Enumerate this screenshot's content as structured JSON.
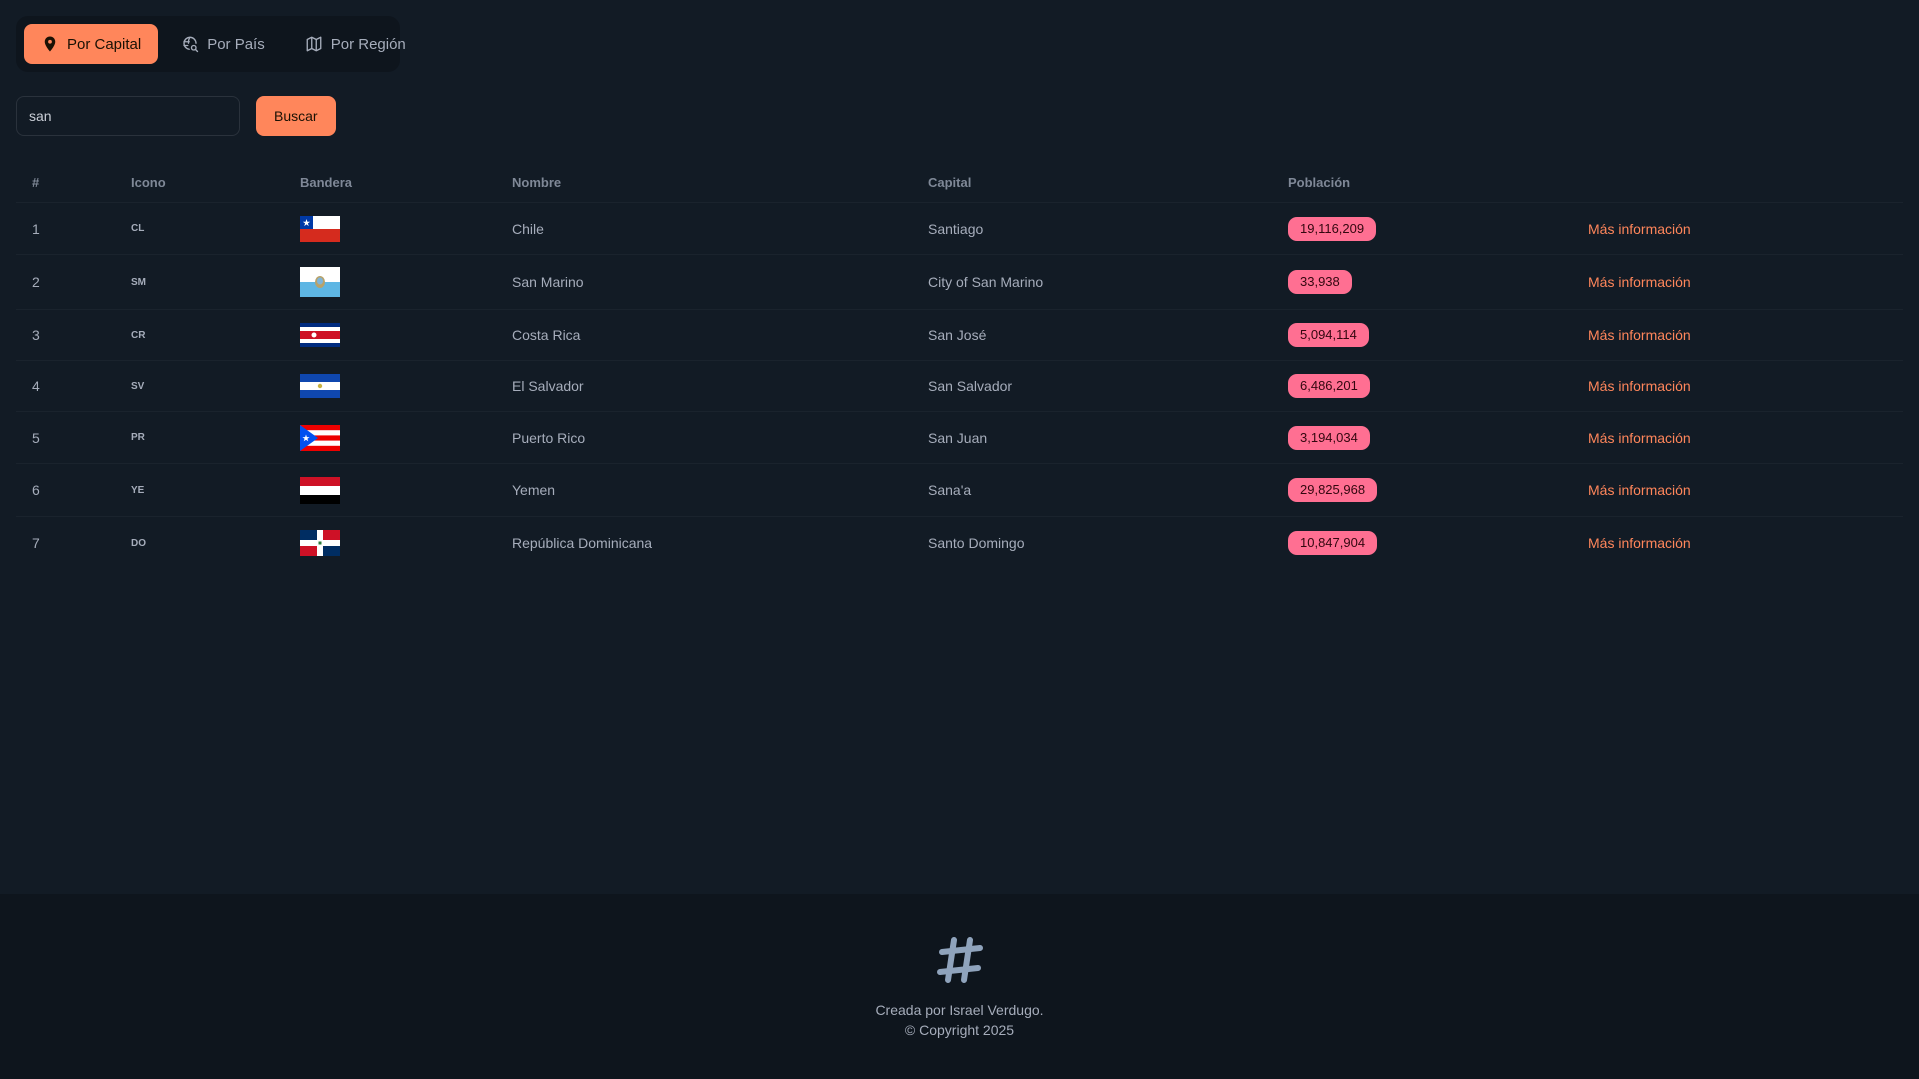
{
  "tabs": [
    {
      "label": "Por Capital",
      "icon": "map-pin-icon",
      "active": true
    },
    {
      "label": "Por País",
      "icon": "globe-search-icon",
      "active": false
    },
    {
      "label": "Por Región",
      "icon": "map-icon",
      "active": false
    }
  ],
  "search": {
    "value": "san",
    "button_label": "Buscar"
  },
  "table": {
    "headers": {
      "num": "#",
      "icon": "Icono",
      "flag": "Bandera",
      "name": "Nombre",
      "capital": "Capital",
      "population": "Población"
    },
    "rows": [
      {
        "num": "1",
        "code": "CL",
        "name": "Chile",
        "capital": "Santiago",
        "population": "19,116,209",
        "more": "Más información"
      },
      {
        "num": "2",
        "code": "SM",
        "name": "San Marino",
        "capital": "City of San Marino",
        "population": "33,938",
        "more": "Más información"
      },
      {
        "num": "3",
        "code": "CR",
        "name": "Costa Rica",
        "capital": "San José",
        "population": "5,094,114",
        "more": "Más información"
      },
      {
        "num": "4",
        "code": "SV",
        "name": "El Salvador",
        "capital": "San Salvador",
        "population": "6,486,201",
        "more": "Más información"
      },
      {
        "num": "5",
        "code": "PR",
        "name": "Puerto Rico",
        "capital": "San Juan",
        "population": "3,194,034",
        "more": "Más información"
      },
      {
        "num": "6",
        "code": "YE",
        "name": "Yemen",
        "capital": "Sana'a",
        "population": "29,825,968",
        "more": "Más información"
      },
      {
        "num": "7",
        "code": "DO",
        "name": "República Dominicana",
        "capital": "Santo Domingo",
        "population": "10,847,904",
        "more": "Más información"
      }
    ]
  },
  "footer": {
    "logo_icon": "hashtag-icon",
    "line1": "Creada por Israel Verdugo.",
    "line2": "© Copyright 2025"
  },
  "colors": {
    "accent": "#ff865b",
    "badge": "#ff6f92",
    "background": "#121b25",
    "footer_background": "#0e151d"
  }
}
